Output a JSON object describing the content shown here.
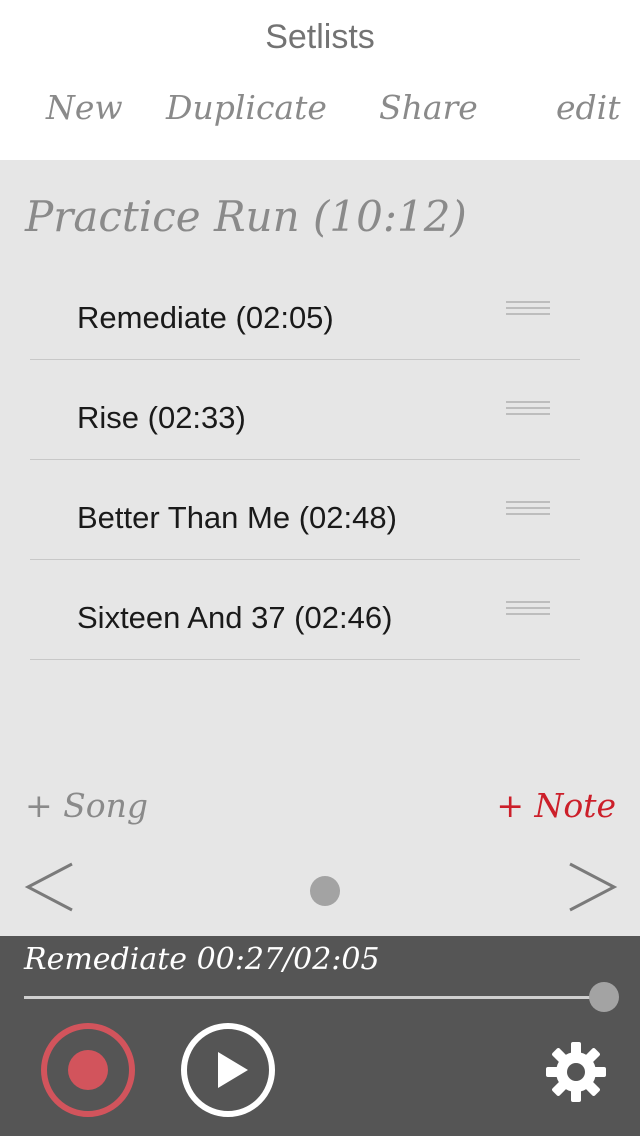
{
  "header": {
    "title": "Setlists",
    "actions": {
      "new": "New",
      "duplicate": "Duplicate",
      "share": "Share",
      "edit": "edit"
    }
  },
  "setlist": {
    "title": "Practice Run (10:12)",
    "songs": [
      {
        "label": "Remediate (02:05)"
      },
      {
        "label": "Rise (02:33)"
      },
      {
        "label": "Better Than Me (02:48)"
      },
      {
        "label": "Sixteen And 37 (02:46)"
      }
    ],
    "add_song": "+ Song",
    "add_note": "+ Note"
  },
  "pager": {
    "prev": "<",
    "next": ">",
    "current_page": 1,
    "page_count": 1
  },
  "player": {
    "now_playing": "Remediate 00:27/02:05",
    "progress_fraction": 1.0
  },
  "icons": {
    "record": "record-icon",
    "play": "play-icon",
    "settings": "gear-icon",
    "drag": "drag-handle-icon"
  },
  "colors": {
    "accent_red": "#cc1f2a",
    "record_red": "#d2545c",
    "player_bg": "#555555",
    "content_bg": "#e6e6e6"
  }
}
